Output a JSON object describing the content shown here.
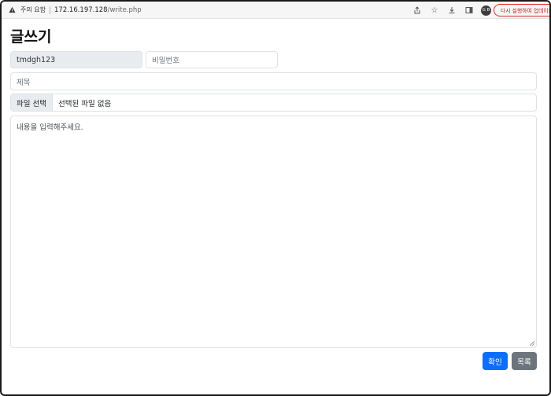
{
  "browser": {
    "security_label": "주의 요함",
    "url_host": "172.16.197.128",
    "url_path": "/write.php",
    "profile_initials": "G B",
    "update_button": "다시 실행하여 업데이트"
  },
  "page": {
    "title": "글쓰기"
  },
  "form": {
    "username_value": "tmdgh123",
    "password_placeholder": "비밀번호",
    "title_placeholder": "제목",
    "file_button_label": "파일 선택",
    "file_status": "선택된 파일 없음",
    "content_placeholder": "내용을 입력해주세요."
  },
  "actions": {
    "confirm_label": "확인",
    "list_label": "목록"
  },
  "colors": {
    "primary": "#0d6efd",
    "secondary": "#6c757d"
  }
}
